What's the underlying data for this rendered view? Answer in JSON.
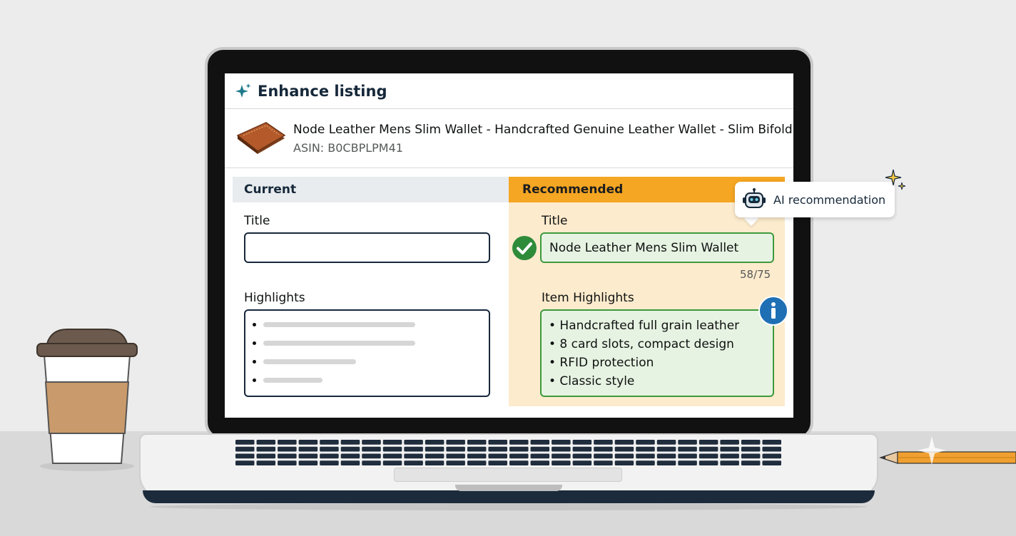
{
  "header": {
    "title": "Enhance listing"
  },
  "product": {
    "title": "Node Leather Mens Slim Wallet - Handcrafted Genuine Leather Wallet - Slim Bifold",
    "asin": "ASIN: B0CBPLPM41"
  },
  "current": {
    "heading": "Current",
    "title_label": "Title",
    "title_value": "",
    "highlights_label": "Highlights",
    "placeholder_bar_fractions": [
      0.85,
      0.85,
      0.52,
      0.33
    ]
  },
  "recommended": {
    "heading": "Recommended",
    "title_label": "Title",
    "title_value": "Node Leather Mens Slim Wallet",
    "char_count": "58/75",
    "highlights_label": "Item Highlights",
    "highlights": [
      "• Handcrafted full grain leather",
      "• 8 card slots, compact design",
      "• RFID protection",
      "• Classic style"
    ]
  },
  "tooltip": {
    "text": "AI recommendation"
  },
  "colors": {
    "accent_orange": "#f5a623",
    "recommended_bg": "#fdebcd",
    "success_green": "#3d9a3d",
    "navy": "#16283a",
    "info_blue": "#1f6fb5"
  },
  "icons": [
    "sparkle-icon",
    "check-circle-icon",
    "info-icon",
    "robot-icon",
    "stars-icon"
  ]
}
